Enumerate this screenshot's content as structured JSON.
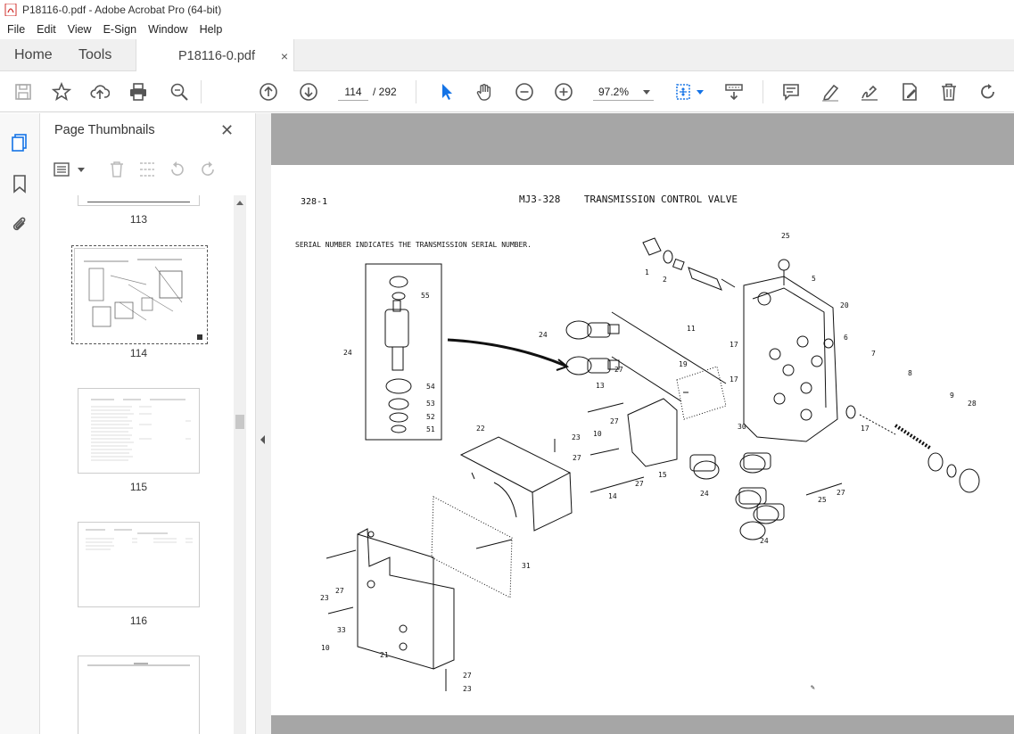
{
  "window": {
    "title": "P18116-0.pdf - Adobe Acrobat Pro (64-bit)"
  },
  "menu": [
    "File",
    "Edit",
    "View",
    "E-Sign",
    "Window",
    "Help"
  ],
  "tabs": {
    "home": "Home",
    "tools": "Tools",
    "document": "P18116-0.pdf",
    "close_glyph": "×"
  },
  "toolbar": {
    "current_page": "114",
    "page_total": "/ 292",
    "zoom": "97.2%",
    "icons": [
      "save-icon",
      "star-icon",
      "upload-icon",
      "print-icon",
      "zoom-search-icon",
      "page-up-icon",
      "page-down-icon",
      "select-arrow-icon",
      "hand-icon",
      "zoom-out-icon",
      "zoom-in-icon",
      "fit-page-icon",
      "scroll-mode-icon",
      "comment-icon",
      "highlight-icon",
      "sign-icon",
      "edit-pdf-icon",
      "delete-icon",
      "rotate-icon"
    ]
  },
  "panel": {
    "title": "Page Thumbnails",
    "close_glyph": "✕",
    "thumbnails": [
      {
        "label": "113"
      },
      {
        "label": "114",
        "selected": true
      },
      {
        "label": "115"
      },
      {
        "label": "116"
      }
    ]
  },
  "document": {
    "page_ref": "328-1",
    "heading": "MJ3-328    TRANSMISSION CONTROL VALVE",
    "note": "SERIAL NUMBER INDICATES THE TRANSMISSION SERIAL NUMBER.",
    "callouts": [
      "1",
      "2",
      "25",
      "5",
      "20",
      "11",
      "17",
      "6",
      "7",
      "8",
      "9",
      "28",
      "24",
      "55",
      "54",
      "53",
      "52",
      "51",
      "13",
      "27",
      "19",
      "10",
      "15",
      "30",
      "22",
      "23",
      "14",
      "31",
      "33",
      "21"
    ]
  },
  "colors": {
    "accent": "#1473e6",
    "viewer_bg": "#a6a6a6",
    "icon": "#555555"
  }
}
